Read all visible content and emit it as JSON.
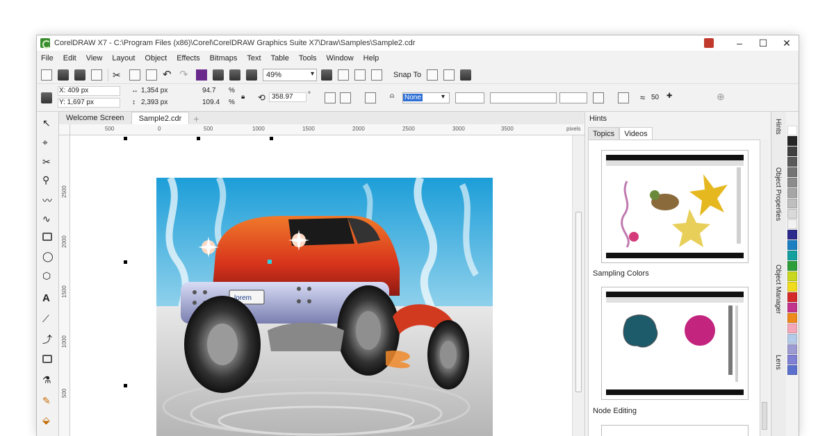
{
  "window": {
    "title": "CorelDRAW X7 - C:\\Program Files (x86)\\Corel\\CorelDRAW Graphics Suite X7\\Draw\\Samples\\Sample2.cdr",
    "controls": {
      "minimize": "–",
      "maximize": "☐",
      "close": "✕"
    }
  },
  "menu": [
    "File",
    "Edit",
    "View",
    "Layout",
    "Object",
    "Effects",
    "Bitmaps",
    "Text",
    "Table",
    "Tools",
    "Window",
    "Help"
  ],
  "toolbar": {
    "zoom": "49%",
    "snap_label": "Snap To",
    "undo": "↶",
    "redo": "↷"
  },
  "property_bar": {
    "x": "X: 409 px",
    "y": "Y: 1,697 px",
    "width": "1,354 px",
    "height": "2,393 px",
    "scale_x": "94.7",
    "scale_y": "109.4",
    "percent": "%",
    "rotation": "358.97",
    "degree": "°",
    "outline_fill": "None",
    "smoothing": "50"
  },
  "doc_tabs": [
    "Welcome Screen",
    "Sample2.cdr"
  ],
  "ruler": {
    "h_ticks": [
      "500",
      "0",
      "500",
      "1000",
      "1500",
      "2000",
      "2500",
      "3000",
      "3500"
    ],
    "unit": "pixels",
    "v_ticks": [
      "2500",
      "2000",
      "1500",
      "1000",
      "500"
    ]
  },
  "artwork": {
    "plate_text": "lorem"
  },
  "hints": {
    "title": "Hints",
    "tabs": [
      "Topics",
      "Videos"
    ],
    "captions": [
      "Sampling Colors",
      "Node Editing"
    ]
  },
  "dockers": [
    "Hints",
    "Object Properties",
    "Object Manager",
    "Lens"
  ],
  "palette": [
    "#ffffff",
    "#262626",
    "#404040",
    "#595959",
    "#737373",
    "#8c8c8c",
    "#a6a6a6",
    "#bfbfbf",
    "#d9d9d9",
    "#f2f2f2",
    "#2c2a8c",
    "#1b7fc2",
    "#15a0a0",
    "#2e9e3a",
    "#c9d81f",
    "#f0dc1e",
    "#d42a2a",
    "#c2338e",
    "#ee8a1c",
    "#f4a7b9",
    "#b3cbe8",
    "#9e9bd3",
    "#7f7fd4",
    "#5b6fcd"
  ]
}
